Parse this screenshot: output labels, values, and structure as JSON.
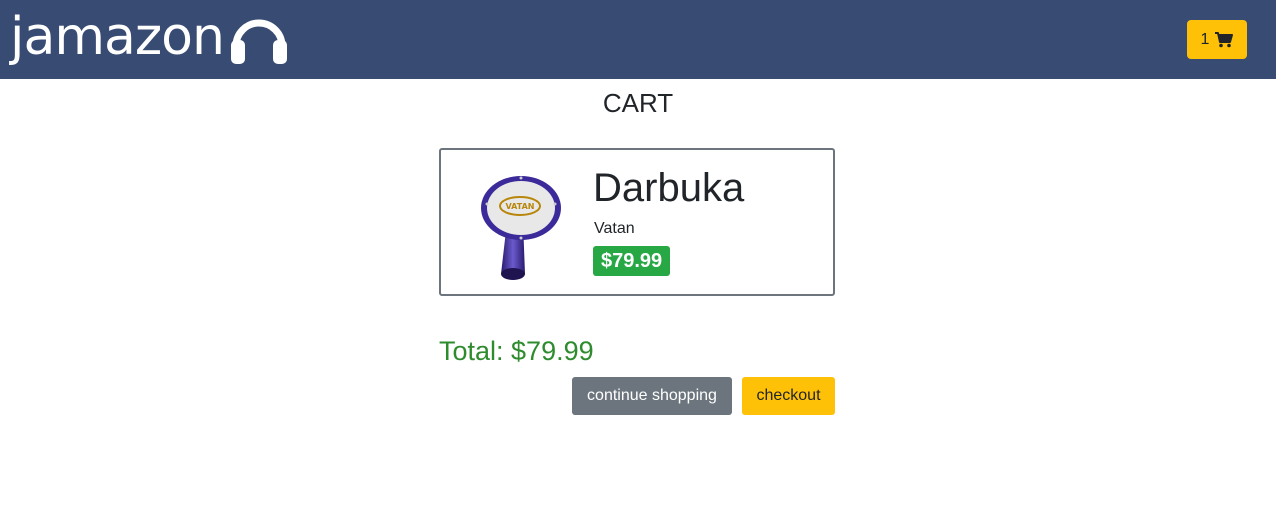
{
  "navbar": {
    "brand_text": "jamazon",
    "brand_icon": "headphones-icon",
    "cart_count": "1",
    "cart_icon": "shopping-cart-icon"
  },
  "page": {
    "title": "CART"
  },
  "cart": {
    "items": [
      {
        "name": "Darbuka",
        "brand": "Vatan",
        "price": "$79.99",
        "image_label": "VATAN"
      }
    ],
    "total": "Total: $79.99"
  },
  "actions": {
    "continue_label": "continue shopping",
    "checkout_label": "checkout"
  },
  "colors": {
    "navbar": "#384b73",
    "accent": "#ffc107",
    "price_badge": "#28a745",
    "total_text": "#2e8b2e",
    "secondary_button": "#6c757d"
  }
}
